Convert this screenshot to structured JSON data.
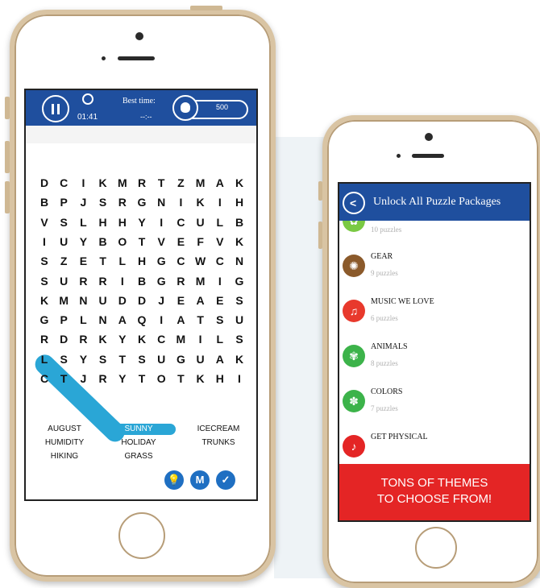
{
  "game": {
    "timer": "01:41",
    "best_time_label": "Best time:",
    "best_time_value": "--:--",
    "coins": "500",
    "grid": [
      "DCIKMRTZMAK",
      "BPJSRGNIKIH",
      "VSLHHYICULB",
      "IUYBOTVEFVK",
      "SZETLHGCWCN",
      "SURRIBGRMIG",
      "KMNUDDJEAES",
      "GPLNAQIATSU",
      "RDRKYKCMILS",
      "LSYSTSUGUAK",
      "CTJRYTOTKHI"
    ],
    "found_word": "SUNNY",
    "words": [
      [
        "AUGUST",
        "SUNNY",
        "ICECREAM"
      ],
      [
        "HUMIDITY",
        "HOLIDAY",
        "TRUNKS"
      ],
      [
        "HIKING",
        "GRASS",
        ""
      ]
    ],
    "buttons": [
      {
        "icon": "bulb-icon",
        "glyph": "💡"
      },
      {
        "icon": "m-icon",
        "glyph": "M"
      },
      {
        "icon": "check-icon",
        "glyph": "✓"
      }
    ]
  },
  "store": {
    "title": "Unlock All Puzzle Packages",
    "packages": [
      {
        "name": "",
        "sub": "10 puzzles",
        "color": "#7ac943",
        "icon": "puzzle-icon",
        "glyph": "✿"
      },
      {
        "name": "GEAR",
        "sub": "9 puzzles",
        "color": "#8b5a2b",
        "icon": "gear-icon",
        "glyph": "✺"
      },
      {
        "name": "MUSIC WE LOVE",
        "sub": "6 puzzles",
        "color": "#e8392c",
        "icon": "music-icon",
        "glyph": "♫"
      },
      {
        "name": "ANIMALS",
        "sub": "8 puzzles",
        "color": "#3cb34a",
        "icon": "paw-icon",
        "glyph": "✾"
      },
      {
        "name": "COLORS",
        "sub": "7 puzzles",
        "color": "#3cb34a",
        "icon": "palette-icon",
        "glyph": "✽"
      },
      {
        "name": "GET PHYSICAL",
        "sub": "",
        "color": "#e42525",
        "icon": "dance-icon",
        "glyph": "♪"
      }
    ],
    "banner_line1": "TONS OF THEMES",
    "banner_line2": "TO CHOOSE FROM!"
  }
}
